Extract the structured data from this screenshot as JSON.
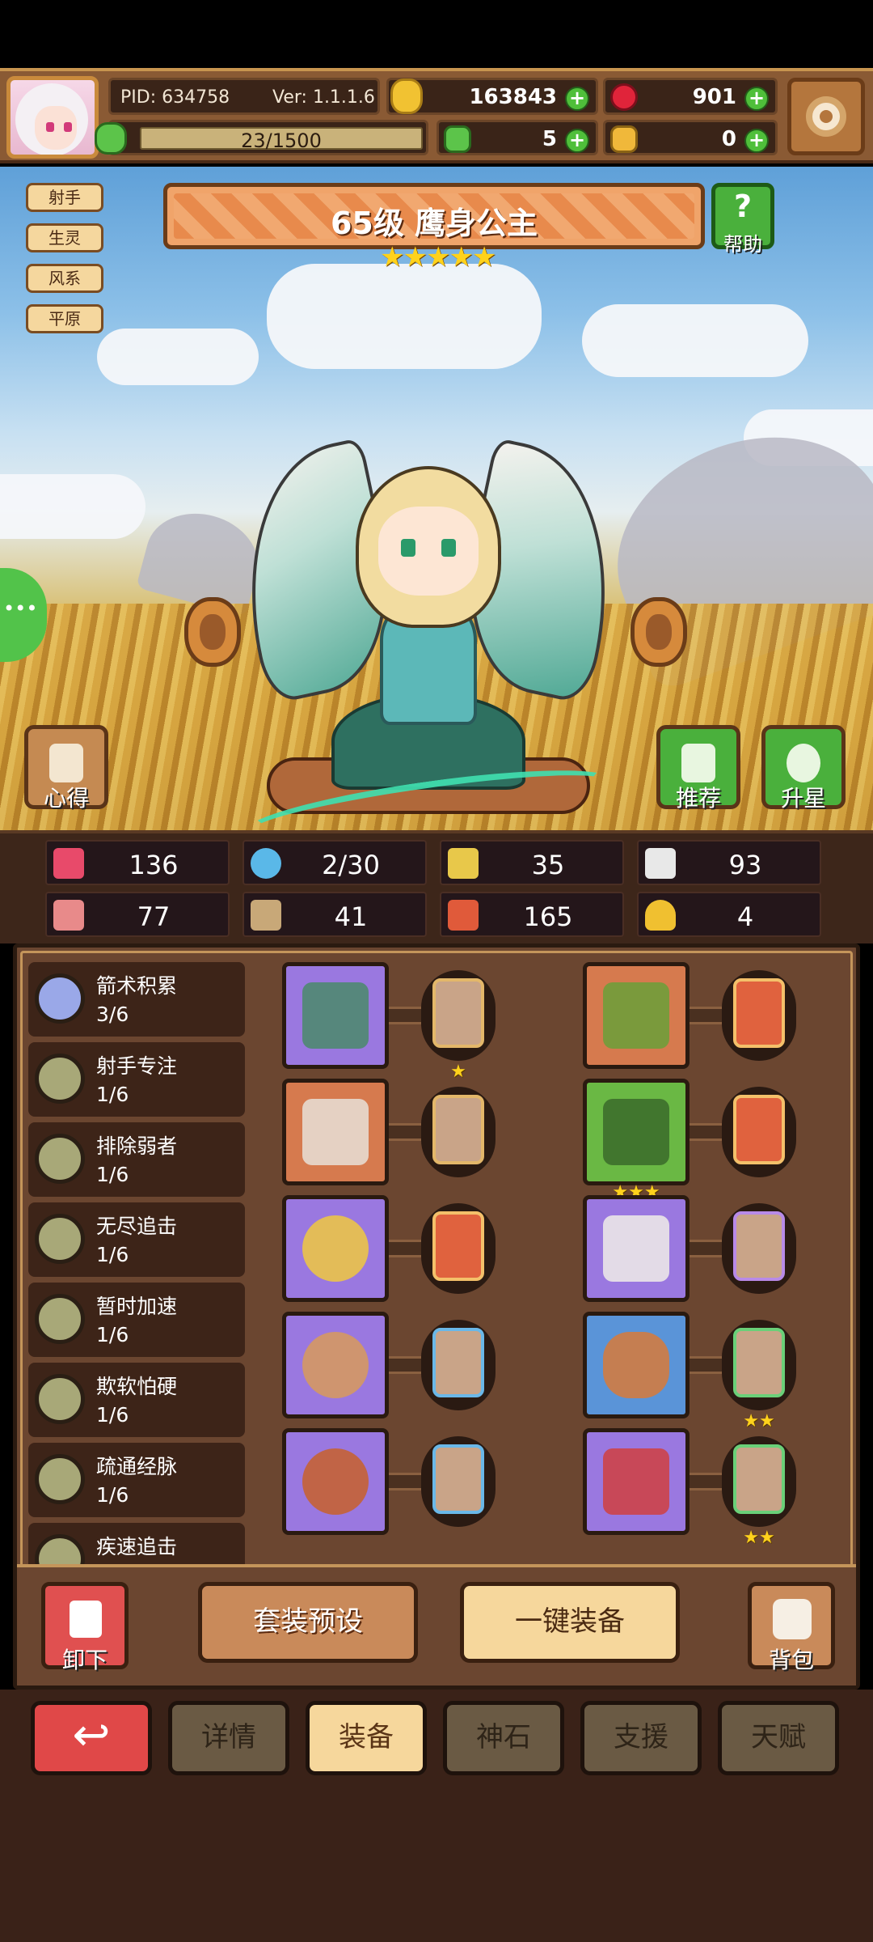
{
  "player": {
    "pid": "PID: 634758",
    "version": "Ver: 1.1.1.6",
    "gold": "163843",
    "gems": "901",
    "exp": "23/1500",
    "clovers": "5",
    "tokens": "0"
  },
  "hero": {
    "tags": [
      "射手",
      "生灵",
      "风系",
      "平原"
    ],
    "title": "65级  鹰身公主",
    "stars": "★★★★★",
    "help_label": "帮助",
    "left_button_label": "心得",
    "recommend_label": "推荐",
    "upstar_label": "升星"
  },
  "stats": [
    {
      "icon": "heart-icon",
      "value": "136",
      "color": "#e84a6a"
    },
    {
      "icon": "drop-icon",
      "value": "2/30",
      "color": "#5ab8e8"
    },
    {
      "icon": "shield-icon",
      "value": "35",
      "color": "#e8c84a"
    },
    {
      "icon": "wing-icon",
      "value": "93",
      "color": "#e8e8e8"
    },
    {
      "icon": "fist-icon",
      "value": "77",
      "color": "#e88a8a"
    },
    {
      "icon": "book-icon",
      "value": "41",
      "color": "#c8a878"
    },
    {
      "icon": "boot-icon",
      "value": "165",
      "color": "#e05a3a"
    },
    {
      "icon": "horseshoe-icon",
      "value": "4",
      "color": "#f0c030"
    }
  ],
  "skills": [
    {
      "name": "箭术积累",
      "level": "3/6"
    },
    {
      "name": "射手专注",
      "level": "1/6"
    },
    {
      "name": "排除弱者",
      "level": "1/6"
    },
    {
      "name": "无尽追击",
      "level": "1/6"
    },
    {
      "name": "暂时加速",
      "level": "1/6"
    },
    {
      "name": "欺软怕硬",
      "level": "1/6"
    },
    {
      "name": "疏通经脉",
      "level": "1/6"
    },
    {
      "name": "疾速追击",
      "level": ""
    }
  ],
  "equipment": [
    {
      "slot": "bow-icon",
      "rarity": "purple",
      "rune_stars": "★"
    },
    {
      "slot": "hood-icon",
      "rarity": "orange",
      "rune_stars": ""
    },
    {
      "slot": "sword-icon",
      "rarity": "orange",
      "rune_stars": ""
    },
    {
      "slot": "armor-icon",
      "rarity": "green",
      "rune_stars": "★★★"
    },
    {
      "slot": "necklace-icon",
      "rarity": "purple",
      "rune_stars": ""
    },
    {
      "slot": "gauntlet-icon",
      "rarity": "purple",
      "rune_stars": ""
    },
    {
      "slot": "shield-icon",
      "rarity": "purple",
      "rune_stars": ""
    },
    {
      "slot": "belt-icon",
      "rarity": "blue",
      "rune_stars": "★★"
    },
    {
      "slot": "ring-icon",
      "rarity": "purple",
      "rune_stars": ""
    },
    {
      "slot": "boots-icon",
      "rarity": "purple",
      "rune_stars": "★★"
    }
  ],
  "actions": {
    "unequip": "卸下",
    "preset": "套装预设",
    "auto_equip": "一键装备",
    "bag": "背包"
  },
  "tabs": {
    "back": "↩",
    "details": "详情",
    "equip": "装备",
    "god_stone": "神石",
    "support": "支援",
    "talent": "天赋"
  }
}
